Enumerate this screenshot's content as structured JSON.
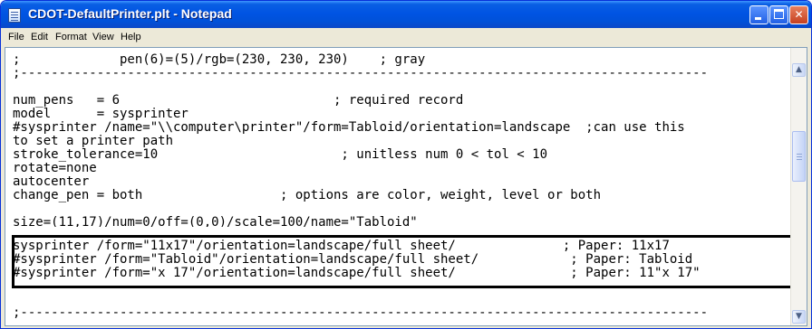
{
  "window": {
    "title": "CDOT-DefaultPrinter.plt - Notepad",
    "controls": {
      "minimize": "minimize",
      "maximize": "maximize",
      "close": "✕"
    }
  },
  "menu": {
    "items": [
      "File",
      "Edit",
      "Format",
      "View",
      "Help"
    ]
  },
  "editor": {
    "lines": [
      ";             pen(6)=(5)/rgb=(230, 230, 230)    ; gray",
      ";------------------------------------------------------------------------------------------",
      "",
      "num_pens   = 6                            ; required record",
      "model      = sysprinter",
      "#sysprinter /name=\"\\\\computer\\printer\"/form=Tabloid/orientation=landscape  ;can use this",
      "to set a printer path",
      "stroke_tolerance=10                        ; unitless num 0 < tol < 10",
      "rotate=none",
      "autocenter",
      "change_pen = both                  ; options are color, weight, level or both",
      "",
      "size=(11,17)/num=0/off=(0,0)/scale=100/name=\"Tabloid\"",
      "sysprinter /form=\"11x17\"/orientation=landscape/full sheet/              ; Paper: 11x17",
      "#sysprinter /form=\"Tabloid\"/orientation=landscape/full sheet/            ; Paper: Tabloid",
      "#sysprinter /form=\"x 17\"/orientation=landscape/full sheet/               ; Paper: 11\"x 17\"",
      "",
      "",
      ";------------------------------------------------------------------------------------------"
    ]
  }
}
